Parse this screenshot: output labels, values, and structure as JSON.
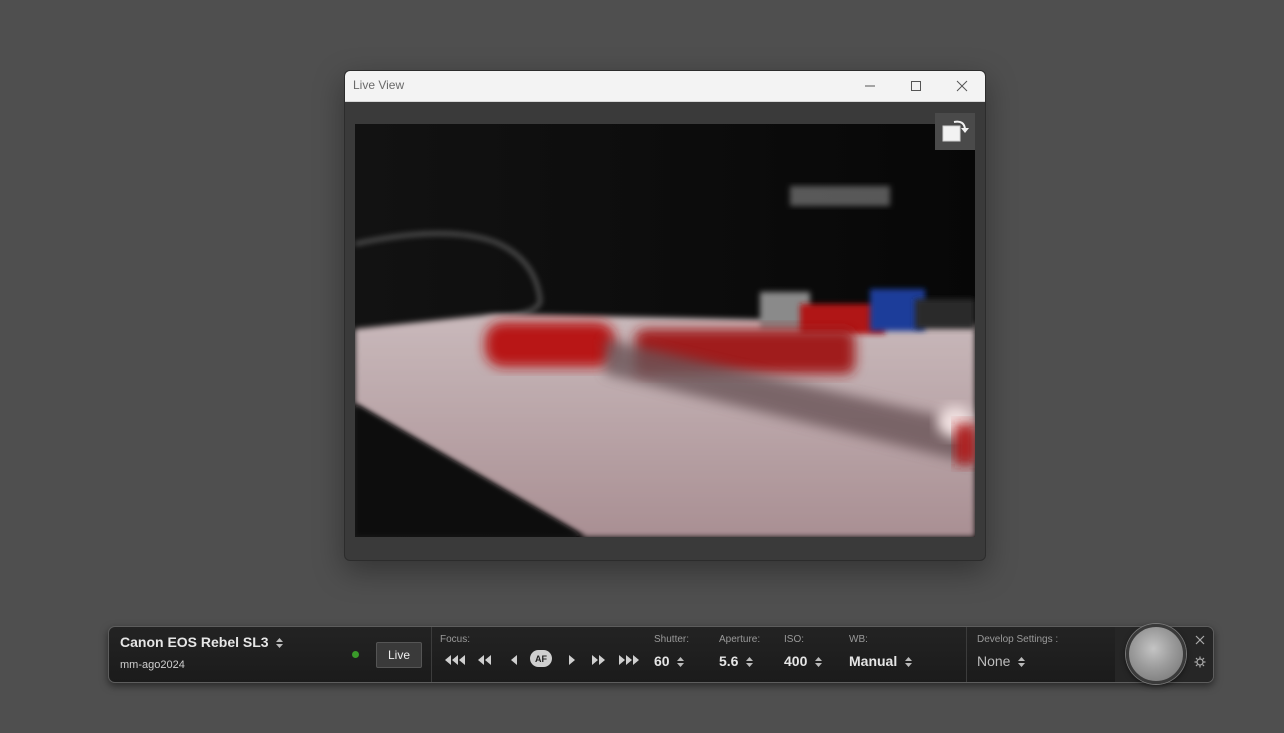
{
  "window": {
    "title": "Live View"
  },
  "icons": {
    "minimize": "minimize-icon",
    "maximize": "maximize-icon",
    "close": "close-icon",
    "rotate": "rotate-icon",
    "sort": "sort-arrows-icon",
    "settings": "gear-icon"
  },
  "camera": {
    "name": "Canon EOS Rebel SL3",
    "session": "mm-ago2024",
    "status_color": "#3a9a2a",
    "live_label": "Live"
  },
  "focus": {
    "label": "Focus:",
    "af_label": "AF"
  },
  "shutter": {
    "label": "Shutter:",
    "value": "60"
  },
  "aperture": {
    "label": "Aperture:",
    "value": "5.6"
  },
  "iso": {
    "label": "ISO:",
    "value": "400"
  },
  "wb": {
    "label": "WB:",
    "value": "Manual"
  },
  "develop": {
    "label": "Develop Settings :",
    "value": "None"
  }
}
